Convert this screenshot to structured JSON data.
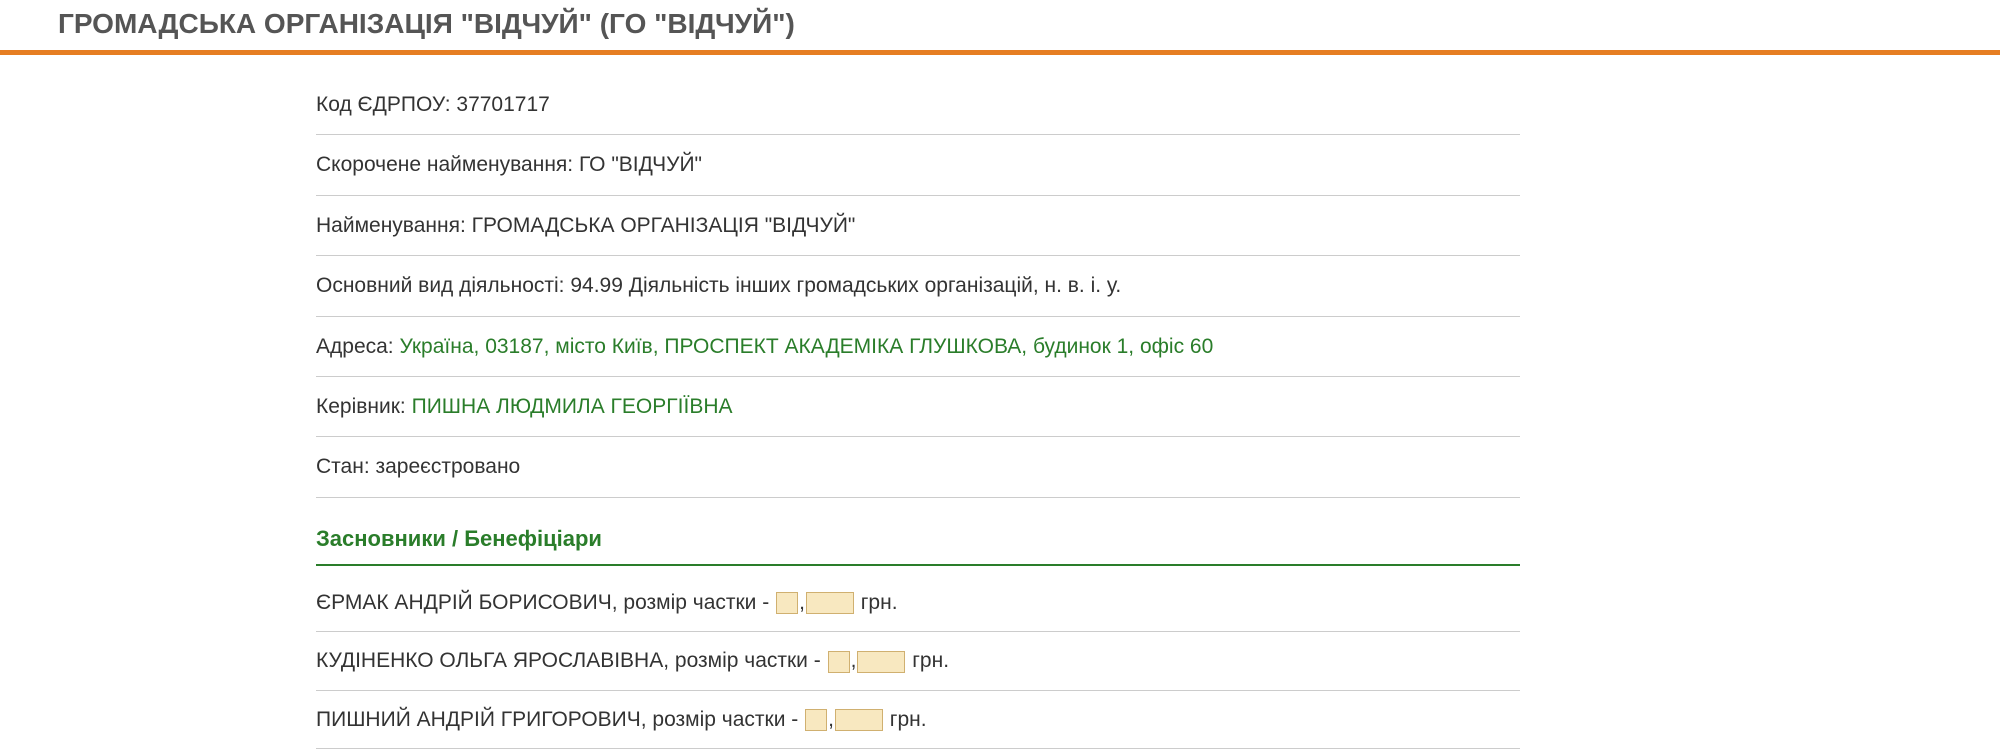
{
  "title": "ГРОМАДСЬКА ОРГАНІЗАЦІЯ \"ВІДЧУЙ\" (ГО \"ВІДЧУЙ\")",
  "info": {
    "edrpou_label": "Код ЄДРПОУ: ",
    "edrpou_value": "37701717",
    "short_name_label": "Скорочене найменування: ",
    "short_name_value": "ГО \"ВІДЧУЙ\"",
    "full_name_label": "Найменування: ",
    "full_name_value": "ГРОМАДСЬКА ОРГАНІЗАЦІЯ \"ВІДЧУЙ\"",
    "activity_label": "Основний вид діяльності: ",
    "activity_value": "94.99 Діяльність інших громадських організацій, н. в. і. у.",
    "address_label": "Адреса: ",
    "address_value": "Україна, 03187, місто Київ, ПРОСПЕКТ АКАДЕМІКА ГЛУШКОВА, будинок 1, офіс 60",
    "director_label": "Керівник: ",
    "director_value": "ПИШНА ЛЮДМИЛА ГЕОРГІЇВНА",
    "status_label": "Стан: ",
    "status_value": "зареєстровано"
  },
  "founders_section_title": "Засновники / Бенефіціари",
  "founders": [
    {
      "name": "ЄРМАК АНДРІЙ БОРИСОВИЧ",
      "share_label": ", розмір частки - ",
      "currency": " грн."
    },
    {
      "name": "КУДІНЕНКО ОЛЬГА ЯРОСЛАВІВНА",
      "share_label": ", розмір частки - ",
      "currency": " грн."
    },
    {
      "name": "ПИШНИЙ АНДРІЙ ГРИГОРОВИЧ",
      "share_label": ", розмір частки - ",
      "currency": " грн."
    }
  ]
}
